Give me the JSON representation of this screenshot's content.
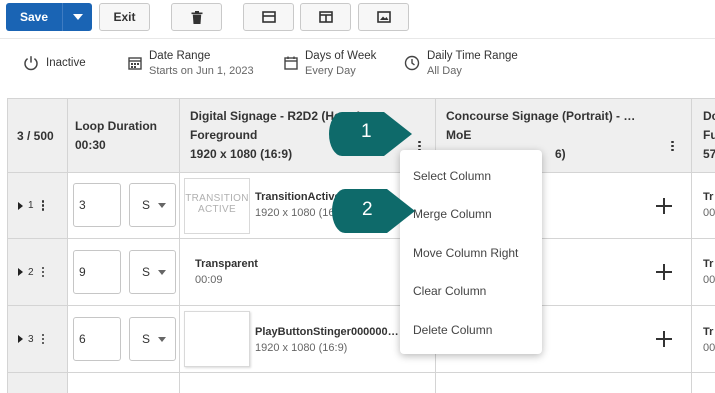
{
  "toolbar": {
    "save_label": "Save",
    "exit_label": "Exit",
    "icons": [
      "trash-icon",
      "layout-rows-icon",
      "layout-columns-icon",
      "image-icon"
    ]
  },
  "status": {
    "active": "Inactive",
    "date_range_label": "Date Range",
    "date_range_value": "Starts on Jun 1, 2023",
    "days_label": "Days of Week",
    "days_value": "Every Day",
    "time_label": "Daily Time Range",
    "time_value": "All Day"
  },
  "grid": {
    "count": "3 / 500",
    "loop_label": "Loop Duration",
    "loop_value": "00:30",
    "columns": [
      {
        "title": "Digital Signage - R2D2 (Ho…  L…",
        "sub": "Foreground",
        "res": "1920 x 1080 (16:9)"
      },
      {
        "title": "Concourse Signage (Portrait) - …",
        "sub": "MoE",
        "res": "6)"
      },
      {
        "title": "Dc",
        "sub": "Fu",
        "res": "57"
      }
    ],
    "rows": [
      {
        "num": "1",
        "duration": "3",
        "unit": "S",
        "media": "TransitionActive.r",
        "media_sub": "1920 x 1080 (16:9",
        "thumb_text": "TRANSITION ACTIVE",
        "side": "Tr",
        "side2": "00"
      },
      {
        "num": "2",
        "duration": "9",
        "unit": "S",
        "media": "Transparent",
        "media_sub": "00:09",
        "side": "Tr",
        "side2": "00"
      },
      {
        "num": "3",
        "duration": "6",
        "unit": "S",
        "media": "PlayButtonStinger000000…",
        "media_sub": "1920 x 1080 (16:9)",
        "side": "Tr",
        "side2": "00"
      }
    ]
  },
  "menu": {
    "items": [
      "Select Column",
      "Merge Column",
      "Move Column Right",
      "Clear Column",
      "Delete Column"
    ]
  },
  "callouts": [
    "1",
    "2"
  ],
  "colors": {
    "primary": "#1a64b4",
    "callout": "#0e6a6a"
  }
}
